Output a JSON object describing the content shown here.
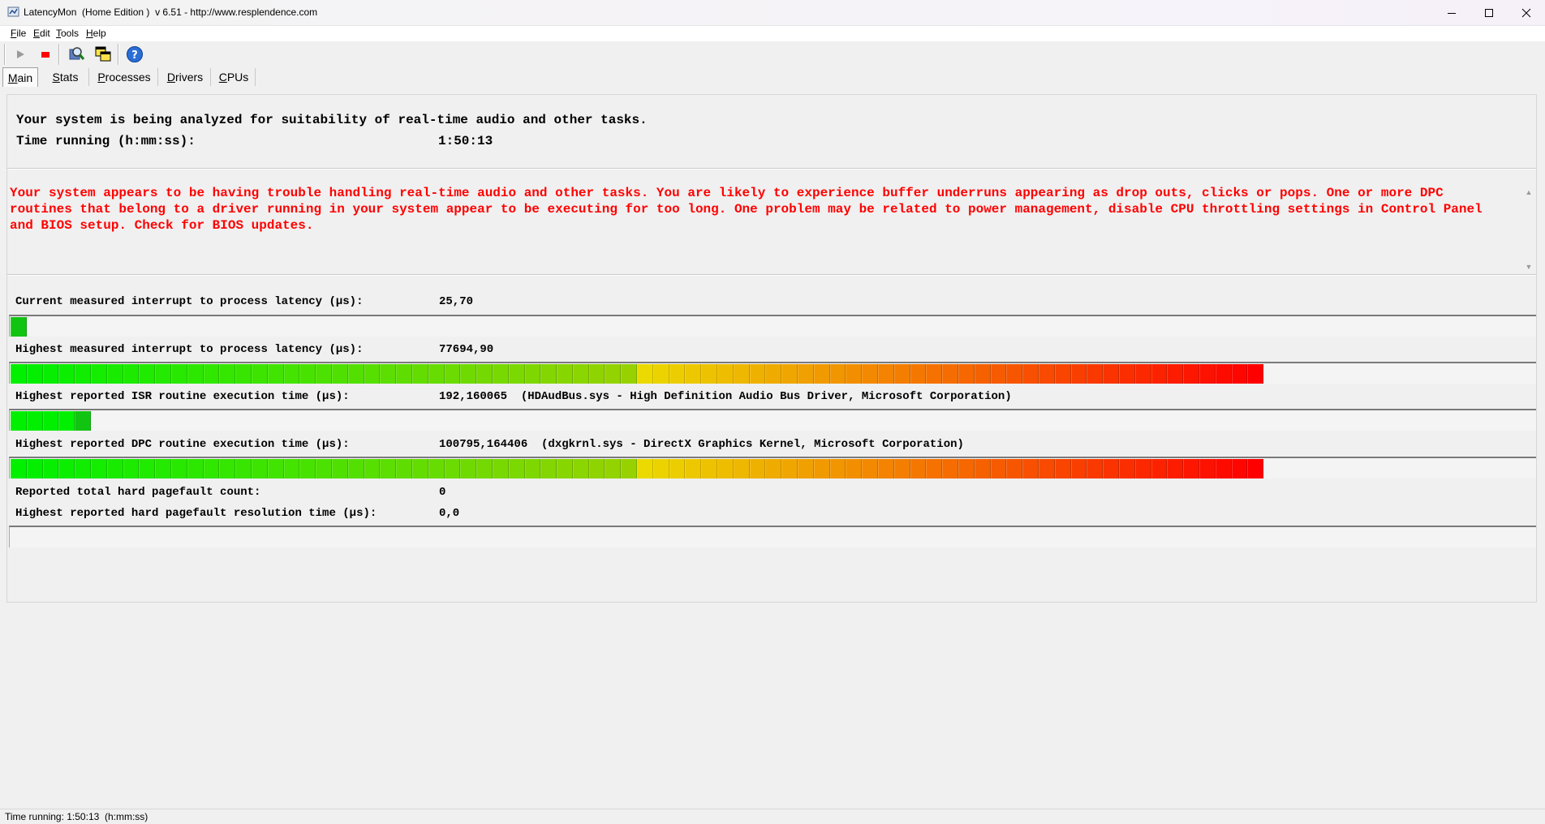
{
  "window": {
    "title": "LatencyMon  (Home Edition )  v 6.51 - http://www.resplendence.com"
  },
  "menu": [
    {
      "label": "File",
      "accel": "F",
      "rest": "ile"
    },
    {
      "label": "Edit",
      "accel": "E",
      "rest": "dit"
    },
    {
      "label": "Tools",
      "accel": "T",
      "rest": "ools"
    },
    {
      "label": "Help",
      "accel": "H",
      "rest": "elp"
    }
  ],
  "toolbar": {
    "icons": [
      "play-icon",
      "stop-icon",
      "analyze-icon",
      "windows-icon",
      "help-icon"
    ]
  },
  "tabs": [
    {
      "label": "Main",
      "accel": "M",
      "rest": "ain",
      "active": true
    },
    {
      "label": "Stats",
      "accel": "S",
      "rest": "tats",
      "active": false
    },
    {
      "label": "Processes",
      "accel": "P",
      "rest": "rocesses",
      "active": false
    },
    {
      "label": "Drivers",
      "accel": "D",
      "rest": "rivers",
      "active": false
    },
    {
      "label": "CPUs",
      "accel": "C",
      "rest": "PUs",
      "active": false
    }
  ],
  "main": {
    "headline": "Your system is being analyzed for suitability of real-time audio and other tasks.",
    "time_running_label": "Time running (h:mm:ss):",
    "time_running_value": "1:50:13",
    "message": "Your system appears to be having trouble handling real-time audio and other tasks. You are likely to experience buffer underruns appearing as drop outs, clicks or pops. One or more DPC routines that belong to a driver running in your system appear to be executing for too long. One problem may be related to power management, disable CPU throttling settings in Control Panel and BIOS setup. Check for BIOS updates.",
    "metrics": {
      "current_latency": {
        "label": "Current measured interrupt to process latency (µs):",
        "value": "25,70",
        "bar_segments": 1
      },
      "highest_latency": {
        "label": "Highest measured interrupt to process latency (µs):",
        "value": "77694,90",
        "bar_segments": 95
      },
      "isr": {
        "label": "Highest reported ISR routine execution time (µs):",
        "value": "192,160065  (HDAudBus.sys - High Definition Audio Bus Driver, Microsoft Corporation)",
        "bar_segments": 5
      },
      "dpc": {
        "label": "Highest reported DPC routine execution time (µs):",
        "value": "100795,164406  (dxgkrnl.sys - DirectX Graphics Kernel, Microsoft Corporation)",
        "bar_segments": 95
      },
      "pagefault_count": {
        "label": "Reported total hard pagefault count:",
        "value": "0"
      },
      "pagefault_time": {
        "label": "Highest reported hard pagefault resolution time (µs):",
        "value": "0,0",
        "bar_segments": 0
      }
    }
  },
  "statusbar": {
    "text": "Time running: 1:50:13  (h:mm:ss)"
  },
  "colors": {
    "warning_text": "#ff0000",
    "bar_start": "#00ff00",
    "bar_end": "#ff0000"
  }
}
